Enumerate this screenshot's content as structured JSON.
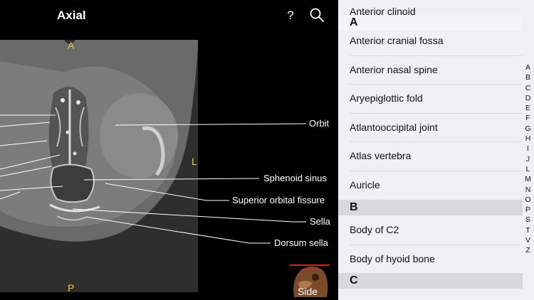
{
  "header": {
    "title": "Axial",
    "help_label": "?"
  },
  "viewer": {
    "orientation": {
      "anterior": "A",
      "posterior": "P",
      "left": "L"
    },
    "labels": {
      "orbit": "Orbit",
      "sphenoid_sinus": "Sphenoid sinus",
      "superior_orbital_fissure": "Superior orbital fissure",
      "sella": "Sella",
      "dorsum_sella": "Dorsum sella"
    },
    "side_view_label": "Side"
  },
  "list": {
    "top_item": "Anterior clinoid",
    "sections": [
      {
        "letter": "A",
        "items": [
          "Anterior cranial fossa",
          "Anterior nasal spine",
          "Aryepiglottic fold",
          "Atlantooccipital joint",
          "Atlas vertebra",
          "Auricle"
        ]
      },
      {
        "letter": "B",
        "items": [
          "Body of C2",
          "Body of hyoid bone"
        ]
      },
      {
        "letter": "C",
        "items": []
      }
    ],
    "index_letters": [
      "A",
      "B",
      "C",
      "D",
      "E",
      "F",
      "G",
      "H",
      "I",
      "J",
      "L",
      "M",
      "N",
      "O",
      "P",
      "S",
      "T",
      "V",
      "Z"
    ]
  },
  "colors": {
    "orientation_marker": "#e8d23a",
    "list_background": "#efeff4",
    "section_header": "#d8d8dc"
  }
}
